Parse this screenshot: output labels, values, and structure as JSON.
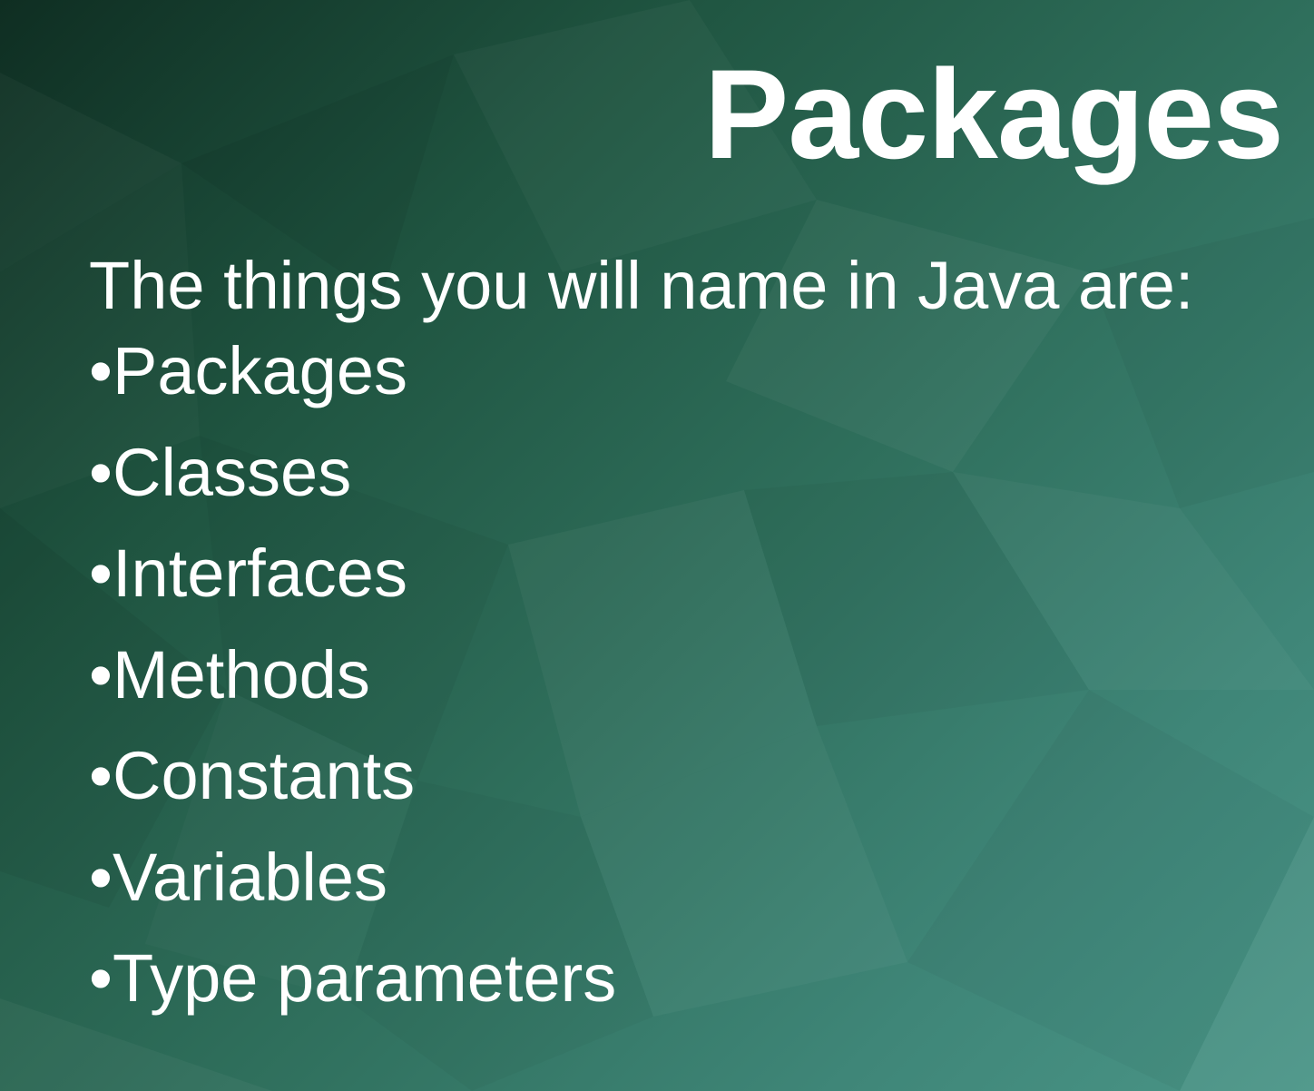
{
  "slide": {
    "title": "Packages",
    "intro": "The things you will name in Java are:",
    "bullet_char": "•",
    "items": [
      "Packages",
      "Classes",
      "Interfaces",
      "Methods",
      "Constants",
      "Variables",
      "Type parameters"
    ]
  },
  "colors": {
    "background_dark": "#0f2e22",
    "background_mid": "#2f6f5c",
    "background_light": "#4a9587",
    "text": "#ffffff"
  }
}
